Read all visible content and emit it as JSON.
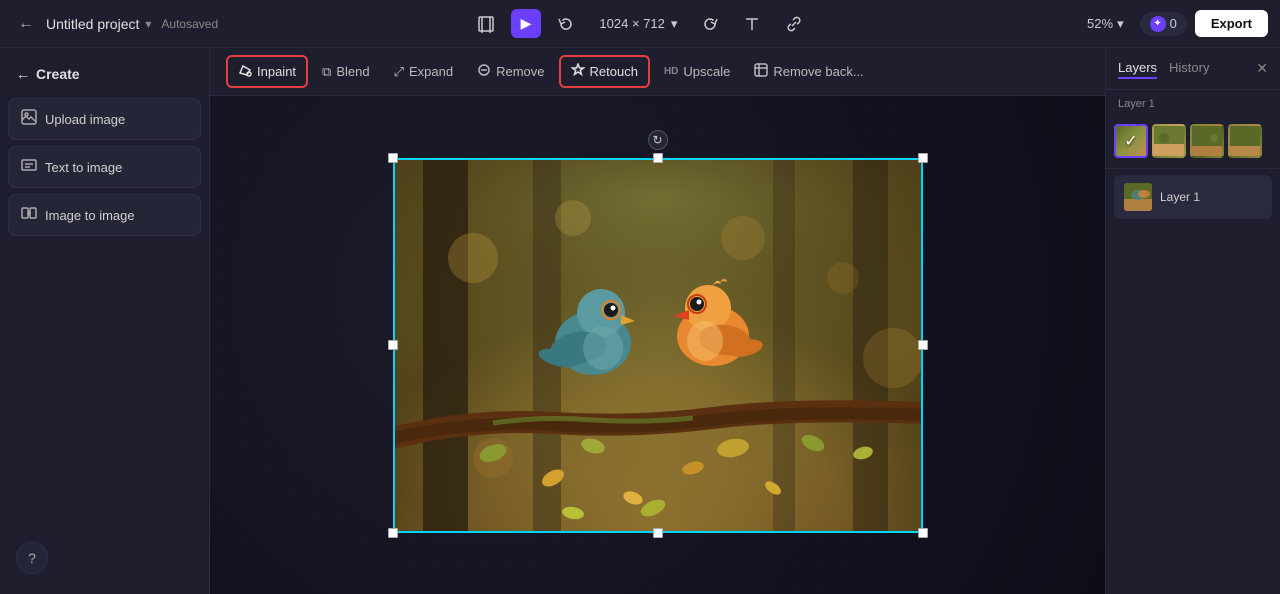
{
  "topbar": {
    "back_label": "←",
    "project_title": "Untitled project",
    "project_chevron": "▾",
    "autosaved": "Autosaved",
    "canvas_size": "1024 × 712",
    "canvas_chevron": "▾",
    "zoom": "52%",
    "zoom_chevron": "▾",
    "credits": "0",
    "export_label": "Export"
  },
  "sidebar": {
    "create_label": "Create",
    "items": [
      {
        "id": "upload-image",
        "icon": "⬆",
        "label": "Upload image"
      },
      {
        "id": "text-to-image",
        "icon": "T",
        "label": "Text to image"
      },
      {
        "id": "image-to-image",
        "icon": "⇄",
        "label": "Image to image"
      }
    ],
    "help_icon": "?"
  },
  "toolbar": {
    "items": [
      {
        "id": "inpaint",
        "icon": "✏",
        "label": "Inpaint",
        "active": true
      },
      {
        "id": "blend",
        "icon": "⧉",
        "label": "Blend",
        "active": false
      },
      {
        "id": "expand",
        "icon": "⤢",
        "label": "Expand",
        "active": false
      },
      {
        "id": "remove",
        "icon": "◎",
        "label": "Remove",
        "active": false
      },
      {
        "id": "retouch",
        "icon": "✦",
        "label": "Retouch",
        "active": true
      },
      {
        "id": "upscale",
        "icon": "HD",
        "label": "Upscale",
        "active": false
      },
      {
        "id": "remove-bg",
        "icon": "⬚",
        "label": "Remove back...",
        "active": false
      }
    ],
    "rotate_icon": "↻"
  },
  "right_panel": {
    "tabs": [
      {
        "id": "layers",
        "label": "Layers",
        "active": true
      },
      {
        "id": "history",
        "label": "History",
        "active": false
      }
    ],
    "close_icon": "✕",
    "section_label": "Layer 1",
    "layer_name": "Layer 1",
    "thumbnails": [
      {
        "id": "thumb-1",
        "selected": true
      },
      {
        "id": "thumb-2",
        "selected": false
      },
      {
        "id": "thumb-3",
        "selected": false
      },
      {
        "id": "thumb-4",
        "selected": false
      }
    ]
  }
}
